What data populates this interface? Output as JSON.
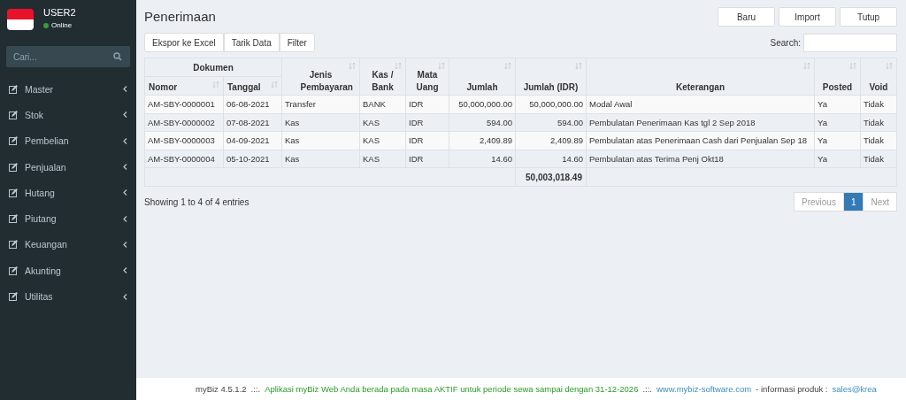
{
  "user": {
    "name": "USER2",
    "status": "Online"
  },
  "sidebar": {
    "search": {
      "placeholder": "Cari..."
    },
    "items": [
      {
        "label": "Master"
      },
      {
        "label": "Stok"
      },
      {
        "label": "Pembelian"
      },
      {
        "label": "Penjualan"
      },
      {
        "label": "Hutang"
      },
      {
        "label": "Piutang"
      },
      {
        "label": "Keuangan"
      },
      {
        "label": "Akunting"
      },
      {
        "label": "Utilitas"
      }
    ]
  },
  "page_title": "Penerimaan",
  "actions": [
    "Baru",
    "Import",
    "Tutup"
  ],
  "tools": [
    "Ekspor ke Excel",
    "Tarik Data",
    "Filter"
  ],
  "search": {
    "label": "Search:"
  },
  "table": {
    "group_header": "Dokumen",
    "columns": [
      "Nomor",
      "Tanggal",
      "Jenis Pembayaran",
      "Kas / Bank",
      "Mata Uang",
      "Jumlah",
      "Jumlah (IDR)",
      "Keterangan",
      "Posted",
      "Void"
    ],
    "rows": [
      [
        "AM-SBY-0000001",
        "06-08-2021",
        "Transfer",
        "BANK",
        "IDR",
        "50,000,000.00",
        "50,000,000.00",
        "Modal Awal",
        "Ya",
        "Tidak"
      ],
      [
        "AM-SBY-0000002",
        "07-08-2021",
        "Kas",
        "KAS",
        "IDR",
        "594.00",
        "594.00",
        "Pembulatan Penerimaan Kas tgl 2 Sep 2018",
        "Ya",
        "Tidak"
      ],
      [
        "AM-SBY-0000003",
        "04-09-2021",
        "Kas",
        "KAS",
        "IDR",
        "2,409.89",
        "2,409.89",
        "Pembulatan atas Penerimaan Cash dari Penjualan Sep 18",
        "Ya",
        "Tidak"
      ],
      [
        "AM-SBY-0000004",
        "05-10-2021",
        "Kas",
        "KAS",
        "IDR",
        "14.60",
        "14.60",
        "Pembulatan atas Terima Penj Okt18",
        "Ya",
        "Tidak"
      ]
    ],
    "total": "50,003,018.49"
  },
  "info": "Showing 1 to 4 of 4 entries",
  "pagination": [
    {
      "label": "Previous",
      "disabled": true,
      "selected": false
    },
    {
      "label": "1",
      "disabled": false,
      "selected": true
    },
    {
      "label": "Next",
      "disabled": true,
      "selected": false
    }
  ],
  "footer": {
    "version": "myBiz 4.5.1.2",
    "separator_1": ".::.",
    "notice": "Aplikasi myBiz Web Anda berada pada masa AKTIF untuk periode sewa sampai dengan 31-12-2026",
    "separator_2": ".::.",
    "website": "www.mybiz-software.com",
    "info_label": "- informasi produk :",
    "email": "sales@krea"
  }
}
